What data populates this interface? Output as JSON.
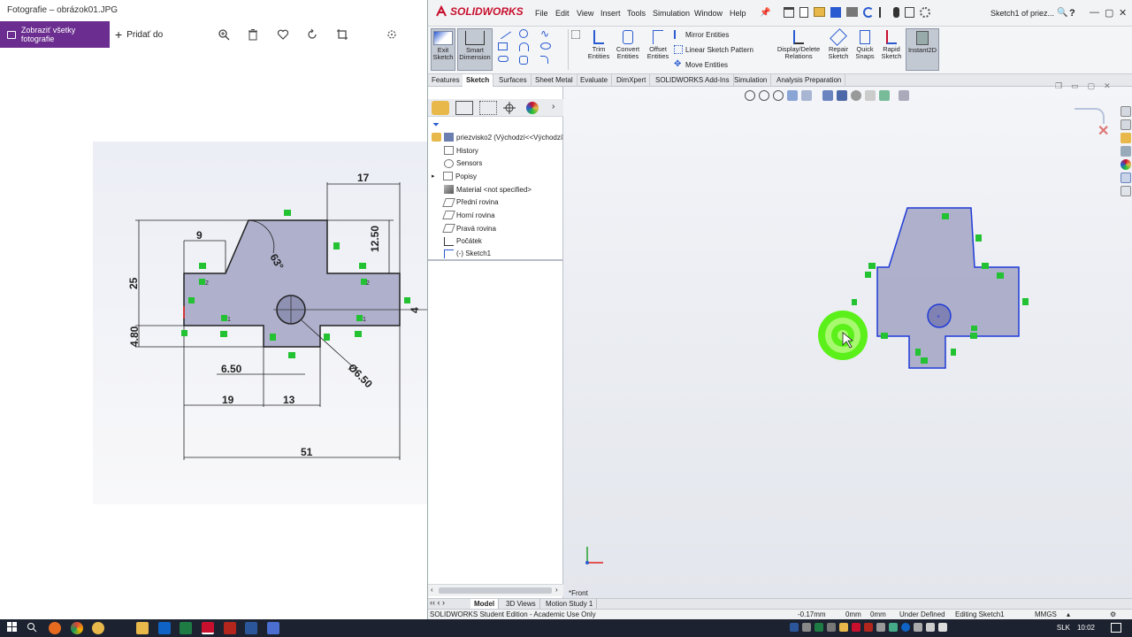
{
  "photos": {
    "window_title": "Fotografie – obrázok01.JPG",
    "show_all_label": "Zobraziť všetky fotografie",
    "add_to_label": "Pridať do",
    "drawing": {
      "dims": [
        "17",
        "9",
        "12.50",
        "63°",
        "25",
        "4.80",
        "6.50",
        "Ø6.50",
        "19",
        "13",
        "51",
        "4"
      ],
      "markers": [
        "2",
        "2",
        "1",
        "1"
      ]
    }
  },
  "sw": {
    "logo": "SOLIDWORKS",
    "menus": [
      "File",
      "Edit",
      "View",
      "Insert",
      "Tools",
      "Simulation",
      "Window",
      "Help"
    ],
    "doc_title": "Sketch1 of priez...",
    "help_icon": "?",
    "cmd": {
      "exit_sketch": "Exit Sketch",
      "smart_dimension": "Smart Dimension",
      "trim_entities": "Trim Entities",
      "convert_entities": "Convert Entities",
      "offset_entities": "Offset Entities",
      "mirror_entities": "Mirror Entities",
      "linear_sketch_pattern": "Linear Sketch Pattern",
      "move_entities": "Move Entities",
      "display_delete_relations": "Display/Delete Relations",
      "repair_sketch": "Repair Sketch",
      "quick_snaps": "Quick Snaps",
      "rapid_sketch": "Rapid Sketch",
      "instant2d": "Instant2D"
    },
    "cm_tabs": [
      "Features",
      "Sketch",
      "Surfaces",
      "Sheet Metal",
      "Evaluate",
      "DimXpert",
      "SOLIDWORKS Add-Ins",
      "Simulation",
      "Analysis Preparation"
    ],
    "active_cm_tab": "Sketch",
    "tree": [
      "priezvisko2  (Východzí<<Východzí>_",
      "History",
      "Sensors",
      "Popisy",
      "Material <not specified>",
      "Přední rovina",
      "Horní rovina",
      "Pravá rovina",
      "Počátek",
      "(-) Sketch1"
    ],
    "view_label": "*Front",
    "bottom_tabs": [
      "Model",
      "3D Views",
      "Motion Study 1"
    ],
    "status": {
      "edition": "SOLIDWORKS Student Edition - Academic Use Only",
      "x": "-0.17mm",
      "y": "0mm",
      "z": "0mm",
      "definition": "Under Defined",
      "editing": "Editing Sketch1",
      "units": "MMGS"
    },
    "colors": {
      "accent": "#c8102e",
      "sketch_line": "#1f3bd8",
      "relation": "#22c232",
      "fill": "#a7a8c6"
    }
  },
  "taskbar": {
    "lang": "SLK",
    "time": "10:02"
  }
}
